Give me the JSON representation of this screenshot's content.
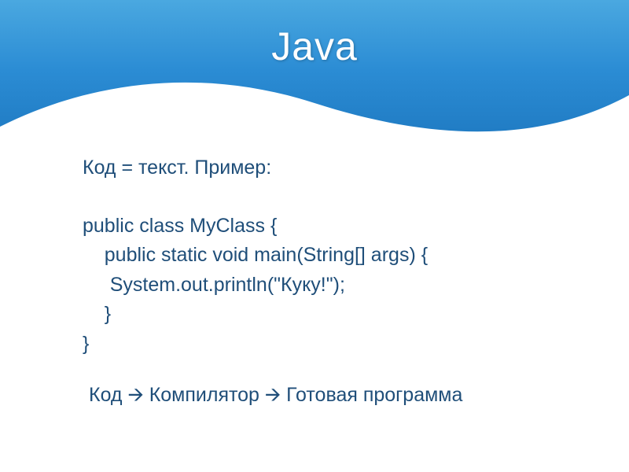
{
  "slide": {
    "title": "Java",
    "intro": "Код = текст. Пример:",
    "code": {
      "l1": "public class MyClass {",
      "l2": "    public static void main(String[] args) {",
      "l3": "     System.out.println(\"Куку!\");",
      "l4": "    }",
      "l5": "}"
    },
    "flow": "Код 🡪 Компилятор 🡪 Готовая программа"
  },
  "colors": {
    "textColor": "#1f4e79",
    "headerGradientTop": "#4aa8e0",
    "headerGradientBottom": "#1f7ac2"
  }
}
